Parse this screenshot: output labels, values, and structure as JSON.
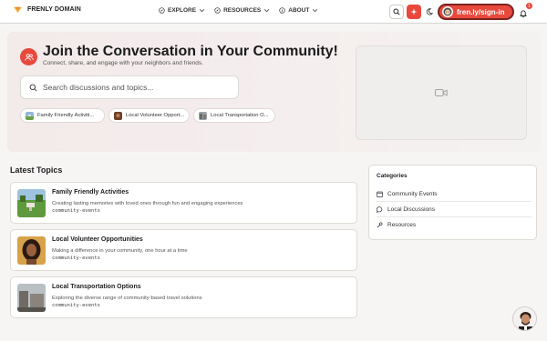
{
  "header": {
    "brand": "FRENLY DOMAIN",
    "nav": [
      {
        "label": "EXPLORE"
      },
      {
        "label": "RESOURCES"
      },
      {
        "label": "ABOUT"
      }
    ],
    "signin_label": "fren.ly/sign-in",
    "notification_count": "1",
    "accent_color": "#e8493c"
  },
  "hero": {
    "title": "Join the Conversation in Your Community!",
    "subtitle": "Connect, share, and engage with your neighbors and friends.",
    "search_placeholder": "Search discussions and topics...",
    "chips": [
      {
        "label": "Family Friendly Activiti..."
      },
      {
        "label": "Local Volunteer Opport..."
      },
      {
        "label": "Local Transportation O..."
      }
    ]
  },
  "latest": {
    "title": "Latest Topics",
    "topics": [
      {
        "title": "Family Friendly Activities",
        "description": "Creating lasting memories with loved ones through fun and engaging experiences",
        "tag": "community-events"
      },
      {
        "title": "Local Volunteer Opportunities",
        "description": "Making a difference in your community, one hour at a time",
        "tag": "community-events"
      },
      {
        "title": "Local Transportation Options",
        "description": "Exploring the diverse range of community-based travel solutions",
        "tag": "community-events"
      }
    ]
  },
  "categories": {
    "title": "Categories",
    "items": [
      {
        "label": "Community Events",
        "icon": "calendar-icon"
      },
      {
        "label": "Local Discussions",
        "icon": "chat-bubble-icon"
      },
      {
        "label": "Resources",
        "icon": "wrench-icon"
      }
    ]
  }
}
